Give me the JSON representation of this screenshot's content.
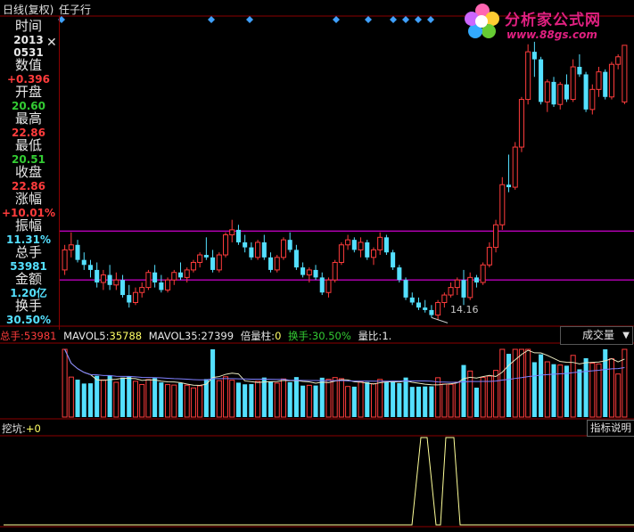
{
  "window": {
    "period_label": "日线(复权)",
    "stock_name": "任子行"
  },
  "watermark": {
    "title": "分析家公式网",
    "url": "www.88gs.com"
  },
  "info_panel": {
    "close_icon": "close-icon",
    "rows": [
      {
        "label": "时间",
        "value_lines": [
          "2013",
          "0531"
        ],
        "color": "#e8e8e8"
      },
      {
        "label": "数值",
        "value": "+0.396",
        "color": "#ff3c3c"
      },
      {
        "label": "开盘",
        "value": "20.60",
        "color": "#33cc33"
      },
      {
        "label": "最高",
        "value": "22.86",
        "color": "#ff3c3c"
      },
      {
        "label": "最低",
        "value": "20.51",
        "color": "#33cc33"
      },
      {
        "label": "收盘",
        "value": "22.86",
        "color": "#ff3c3c"
      },
      {
        "label": "涨幅",
        "value": "+10.01%",
        "color": "#ff3c3c"
      },
      {
        "label": "振幅",
        "value": "11.31%",
        "color": "#54e0ff"
      },
      {
        "label": "总手",
        "value": "53981",
        "color": "#54e0ff"
      },
      {
        "label": "金额",
        "value": "1.20亿",
        "color": "#54e0ff"
      },
      {
        "label": "换手",
        "value": "30.50%",
        "color": "#54e0ff"
      }
    ]
  },
  "price_chart": {
    "low_marker": "14.16"
  },
  "volume_legend": {
    "total_label": "总手:",
    "total_value": "53981",
    "mavol5_label": "MAVOL5:",
    "mavol5_value": "35788",
    "mavol35_label": "MAVOL35:",
    "mavol35_value": "27399",
    "bei_label": "倍量柱:",
    "bei_value": "0",
    "turnover_label": "换手:",
    "turnover_value": "30.50%",
    "vol_ratio_label": "量比:",
    "vol_ratio_value": "1."
  },
  "volume_dropdown": {
    "selected": "成交量"
  },
  "indicator": {
    "name": "挖坑:",
    "value": "+0",
    "explain_button": "指标说明"
  },
  "colors": {
    "up": "#ff3c3c",
    "down": "#54e0ff",
    "hline": "#ff00ff",
    "diamond": "#3fa0ff",
    "frame": "#8b0000"
  },
  "chart_data": {
    "type": "candlestick",
    "title": "",
    "candles": [
      [
        13.9,
        14.9,
        13.7,
        14.7
      ],
      [
        14.7,
        15.4,
        14.4,
        14.9
      ],
      [
        14.9,
        15.1,
        14.2,
        14.3
      ],
      [
        14.3,
        14.6,
        13.9,
        14.1
      ],
      [
        14.1,
        14.3,
        13.6,
        13.9
      ],
      [
        13.9,
        14.2,
        13.2,
        13.4
      ],
      [
        13.4,
        13.9,
        13.1,
        13.7
      ],
      [
        13.7,
        14.1,
        13.1,
        13.3
      ],
      [
        13.3,
        13.8,
        13.1,
        13.5
      ],
      [
        13.5,
        13.7,
        12.8,
        12.9
      ],
      [
        12.9,
        13.3,
        12.4,
        12.6
      ],
      [
        12.6,
        13.2,
        12.5,
        13.0
      ],
      [
        13.0,
        13.4,
        12.8,
        13.2
      ],
      [
        13.2,
        13.9,
        13.1,
        13.8
      ],
      [
        13.8,
        14.1,
        13.2,
        13.4
      ],
      [
        13.4,
        13.7,
        13.0,
        13.1
      ],
      [
        13.1,
        13.6,
        13.0,
        13.5
      ],
      [
        13.5,
        13.9,
        13.3,
        13.8
      ],
      [
        13.8,
        14.2,
        13.5,
        13.6
      ],
      [
        13.6,
        14.0,
        13.4,
        13.9
      ],
      [
        13.9,
        14.3,
        13.8,
        14.2
      ],
      [
        14.2,
        14.6,
        14.0,
        14.5
      ],
      [
        14.5,
        15.2,
        14.3,
        14.4
      ],
      [
        14.4,
        14.7,
        13.8,
        13.9
      ],
      [
        13.9,
        14.6,
        13.8,
        14.5
      ],
      [
        14.5,
        15.4,
        14.4,
        15.3
      ],
      [
        15.3,
        15.9,
        15.0,
        15.5
      ],
      [
        15.5,
        15.7,
        14.9,
        15.0
      ],
      [
        15.0,
        15.3,
        14.6,
        14.8
      ],
      [
        14.8,
        15.0,
        14.3,
        14.4
      ],
      [
        14.4,
        15.1,
        14.3,
        15.0
      ],
      [
        15.0,
        15.3,
        14.3,
        14.4
      ],
      [
        14.4,
        14.6,
        13.8,
        13.9
      ],
      [
        13.9,
        14.5,
        13.8,
        14.4
      ],
      [
        14.4,
        15.2,
        14.3,
        15.1
      ],
      [
        15.1,
        15.4,
        14.6,
        14.7
      ],
      [
        14.7,
        14.9,
        13.9,
        14.0
      ],
      [
        14.0,
        14.2,
        13.6,
        13.7
      ],
      [
        13.7,
        14.0,
        13.4,
        13.9
      ],
      [
        13.9,
        14.1,
        13.5,
        13.6
      ],
      [
        13.6,
        13.8,
        12.9,
        13.0
      ],
      [
        13.0,
        13.6,
        12.8,
        13.5
      ],
      [
        13.5,
        14.3,
        13.4,
        14.2
      ],
      [
        14.2,
        15.0,
        14.1,
        14.9
      ],
      [
        14.9,
        15.3,
        14.7,
        15.1
      ],
      [
        15.1,
        15.2,
        14.6,
        14.7
      ],
      [
        14.7,
        15.2,
        14.4,
        15.0
      ],
      [
        15.0,
        15.1,
        14.3,
        14.4
      ],
      [
        14.4,
        14.8,
        14.1,
        14.7
      ],
      [
        14.7,
        15.4,
        14.5,
        15.2
      ],
      [
        15.2,
        15.3,
        14.5,
        14.6
      ],
      [
        14.6,
        14.7,
        13.9,
        14.0
      ],
      [
        14.0,
        14.1,
        13.4,
        13.5
      ],
      [
        13.5,
        13.6,
        12.7,
        12.8
      ],
      [
        12.8,
        13.0,
        12.5,
        12.6
      ],
      [
        12.6,
        12.8,
        12.3,
        12.4
      ],
      [
        12.4,
        12.7,
        12.2,
        12.3
      ],
      [
        12.3,
        12.5,
        12.0,
        12.1
      ],
      [
        12.1,
        12.7,
        11.9,
        12.6
      ],
      [
        12.6,
        13.0,
        12.4,
        12.9
      ],
      [
        12.9,
        13.4,
        12.8,
        13.2
      ],
      [
        13.2,
        13.6,
        12.9,
        13.5
      ],
      [
        13.5,
        13.9,
        12.5,
        12.8
      ],
      [
        12.8,
        13.8,
        12.7,
        13.6
      ],
      [
        13.6,
        13.7,
        13.2,
        13.4
      ],
      [
        13.4,
        14.2,
        13.3,
        14.1
      ],
      [
        14.1,
        15.0,
        14.0,
        14.8
      ],
      [
        14.8,
        15.9,
        14.6,
        15.7
      ],
      [
        15.7,
        17.6,
        15.5,
        17.3
      ],
      [
        17.3,
        18.5,
        17.0,
        17.2
      ],
      [
        17.2,
        19.0,
        17.1,
        18.8
      ],
      [
        18.8,
        20.8,
        18.6,
        20.7
      ],
      [
        20.7,
        22.9,
        20.5,
        22.6
      ],
      [
        22.6,
        23.0,
        21.6,
        22.3
      ],
      [
        22.3,
        22.4,
        20.5,
        20.6
      ],
      [
        20.6,
        21.5,
        20.2,
        21.4
      ],
      [
        21.4,
        21.6,
        20.4,
        20.5
      ],
      [
        20.5,
        21.4,
        20.3,
        21.3
      ],
      [
        21.3,
        21.7,
        20.6,
        20.7
      ],
      [
        20.7,
        22.3,
        20.6,
        22.0
      ],
      [
        22.0,
        22.5,
        21.6,
        21.7
      ],
      [
        21.7,
        21.8,
        20.2,
        20.3
      ],
      [
        20.3,
        21.3,
        20.1,
        21.1
      ],
      [
        21.1,
        22.0,
        20.8,
        21.8
      ],
      [
        21.8,
        21.9,
        20.7,
        20.8
      ],
      [
        20.8,
        22.2,
        20.7,
        22.1
      ],
      [
        22.1,
        22.5,
        21.9,
        22.4
      ],
      [
        20.6,
        22.86,
        20.51,
        22.86
      ]
    ],
    "horizontal_lines": [
      15.45,
      13.5
    ],
    "signal_days": [
      7,
      67,
      119,
      165,
      148,
      142,
      157,
      172
    ]
  }
}
